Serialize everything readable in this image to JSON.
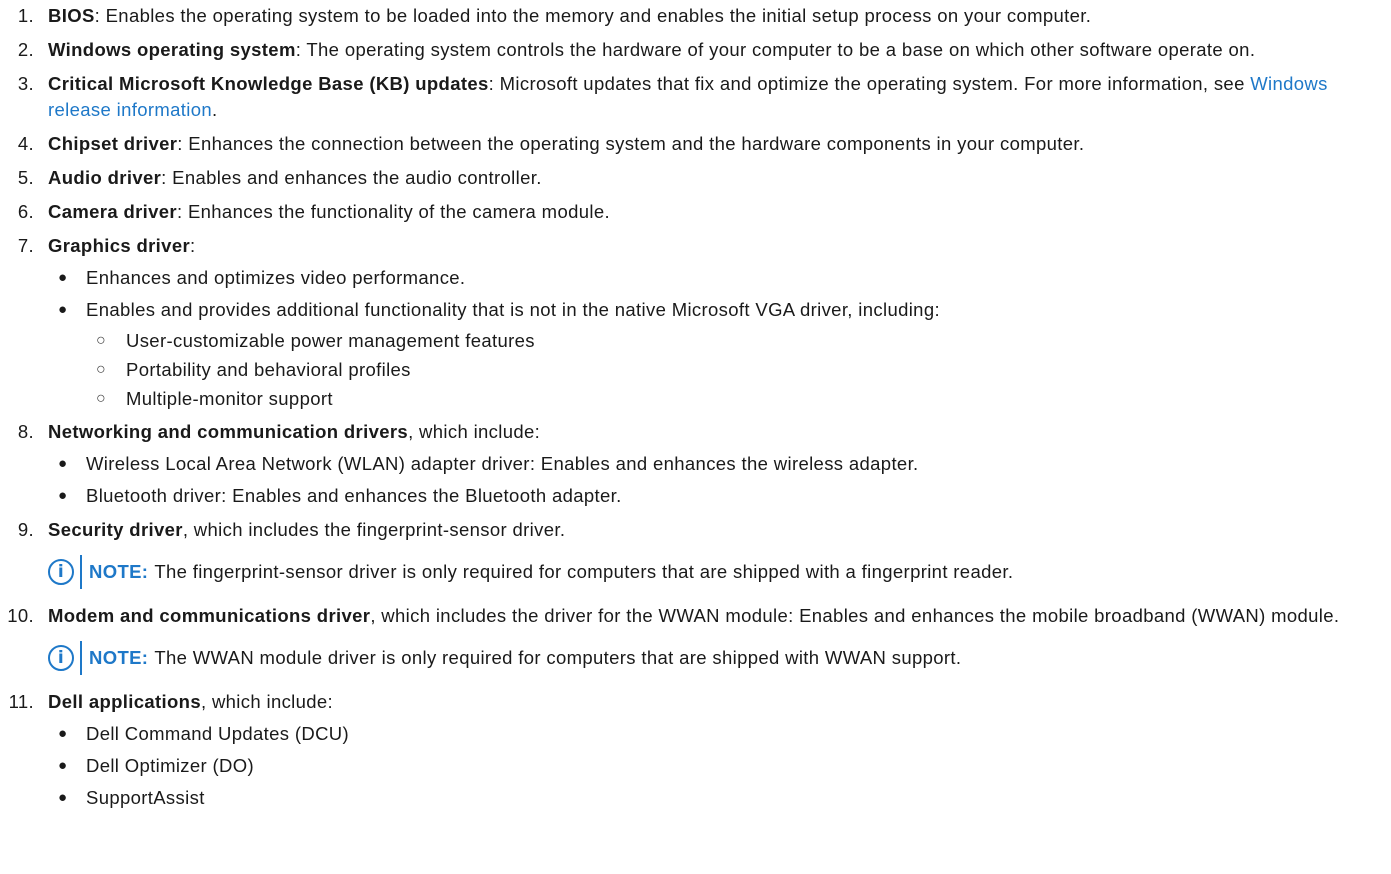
{
  "items": [
    {
      "num": "1.",
      "title": "BIOS",
      "text": ": Enables the operating system to be loaded into the memory and enables the initial setup process on your computer."
    },
    {
      "num": "2.",
      "title": "Windows operating system",
      "text": ": The operating system controls the hardware of your computer to be a base on which other software operate on."
    },
    {
      "num": "3.",
      "title": "Critical Microsoft Knowledge Base (KB) updates",
      "text": ": Microsoft updates that fix and optimize the operating system. For more information, see ",
      "link": "Windows release information",
      "after": "."
    },
    {
      "num": "4.",
      "title": "Chipset driver",
      "text": ": Enhances the connection between the operating system and the hardware components in your computer."
    },
    {
      "num": "5.",
      "title": "Audio driver",
      "text": ": Enables and enhances the audio controller."
    },
    {
      "num": "6.",
      "title": "Camera driver",
      "text": ": Enhances the functionality of the camera module."
    },
    {
      "num": "7.",
      "title": "Graphics driver",
      "text": ":",
      "bullets": [
        "Enhances and optimizes video performance.",
        "Enables and provides additional functionality that is not in the native Microsoft VGA driver, including:"
      ],
      "subbullets": [
        "User-customizable power management features",
        "Portability and behavioral profiles",
        "Multiple-monitor support"
      ]
    },
    {
      "num": "8.",
      "title": "Networking and communication drivers",
      "text": ", which include:",
      "bullets": [
        "Wireless Local Area Network (WLAN) adapter driver: Enables and enhances the wireless adapter.",
        "Bluetooth driver: Enables and enhances the Bluetooth adapter."
      ]
    },
    {
      "num": "9.",
      "title": "Security driver",
      "text": ", which includes the fingerprint-sensor driver.",
      "note": "The fingerprint-sensor driver is only required for computers that are shipped with a fingerprint reader."
    },
    {
      "num": "10.",
      "title": "Modem and communications driver",
      "text": ", which includes the driver for the WWAN module: Enables and enhances the mobile broadband (WWAN) module.",
      "note": "The WWAN module driver is only required for computers that are shipped with WWAN support."
    },
    {
      "num": "11.",
      "title": "Dell applications",
      "text": ", which include:",
      "bullets": [
        "Dell Command Updates (DCU)",
        "Dell Optimizer (DO)",
        "SupportAssist"
      ]
    }
  ],
  "note_label": "NOTE:",
  "note_icon": "i",
  "bullet_glyph": "●",
  "subbullet_glyph": "○",
  "colors": {
    "link": "#1e78c8",
    "text": "#1a1a1a"
  }
}
